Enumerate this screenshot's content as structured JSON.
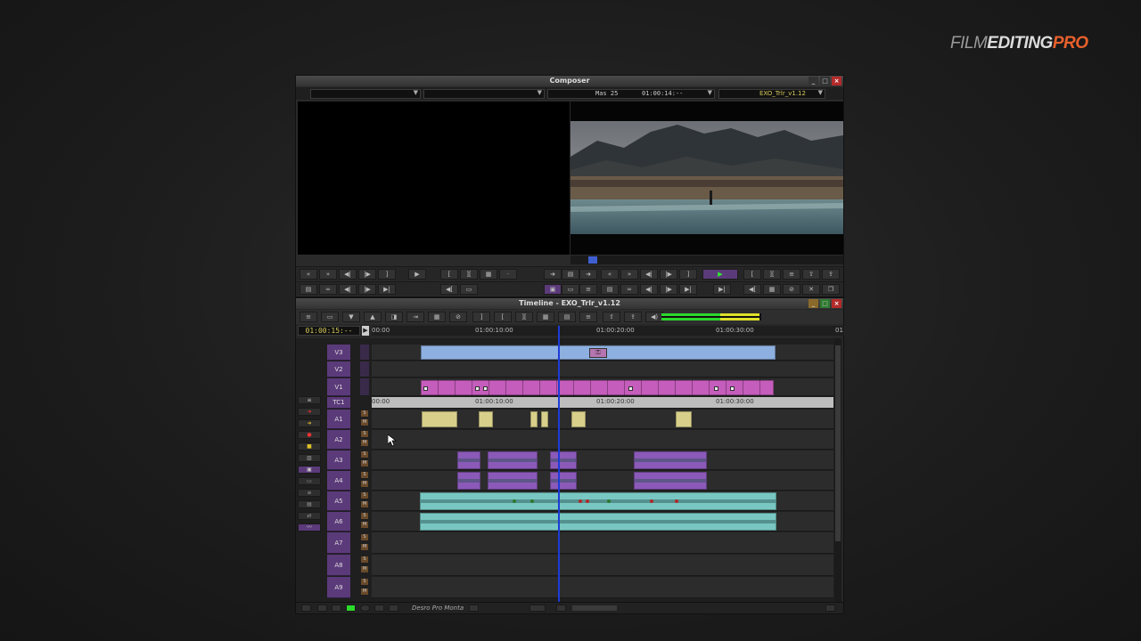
{
  "brand": {
    "part1": "FILM",
    "part2": "EDITING",
    "part3": "PRO"
  },
  "composer": {
    "title": "Composer",
    "source_info": "Mas 25",
    "timecode": "01:00:14:--",
    "sequence": "EXO_Trlr_v1.12"
  },
  "timeline": {
    "title": "Timeline - EXO_Trlr_v1.12",
    "current_tc": "01:00:15:--",
    "ruler": [
      "00:00",
      "01:00:10:00",
      "01:00:20:00",
      "01:00:30:00",
      "01"
    ],
    "tc_ruler": [
      "00:00",
      "01:00:10:00",
      "01:00:20:00",
      "01:00:30:00"
    ],
    "tracks": [
      "V3",
      "V2",
      "V1",
      "TC1",
      "A1",
      "A2",
      "A3",
      "A4",
      "A5",
      "A6",
      "A7",
      "A8",
      "A9"
    ],
    "bottom_label": "Desro Pro Monta"
  },
  "colors": {
    "track_label": "#5b3a7a",
    "playhead": "#1d3bd8",
    "video_clip": "#c45dbb",
    "title_clip": "#8db0e0",
    "audio_clip": "#79c7c2",
    "accent": "#e8602c"
  }
}
